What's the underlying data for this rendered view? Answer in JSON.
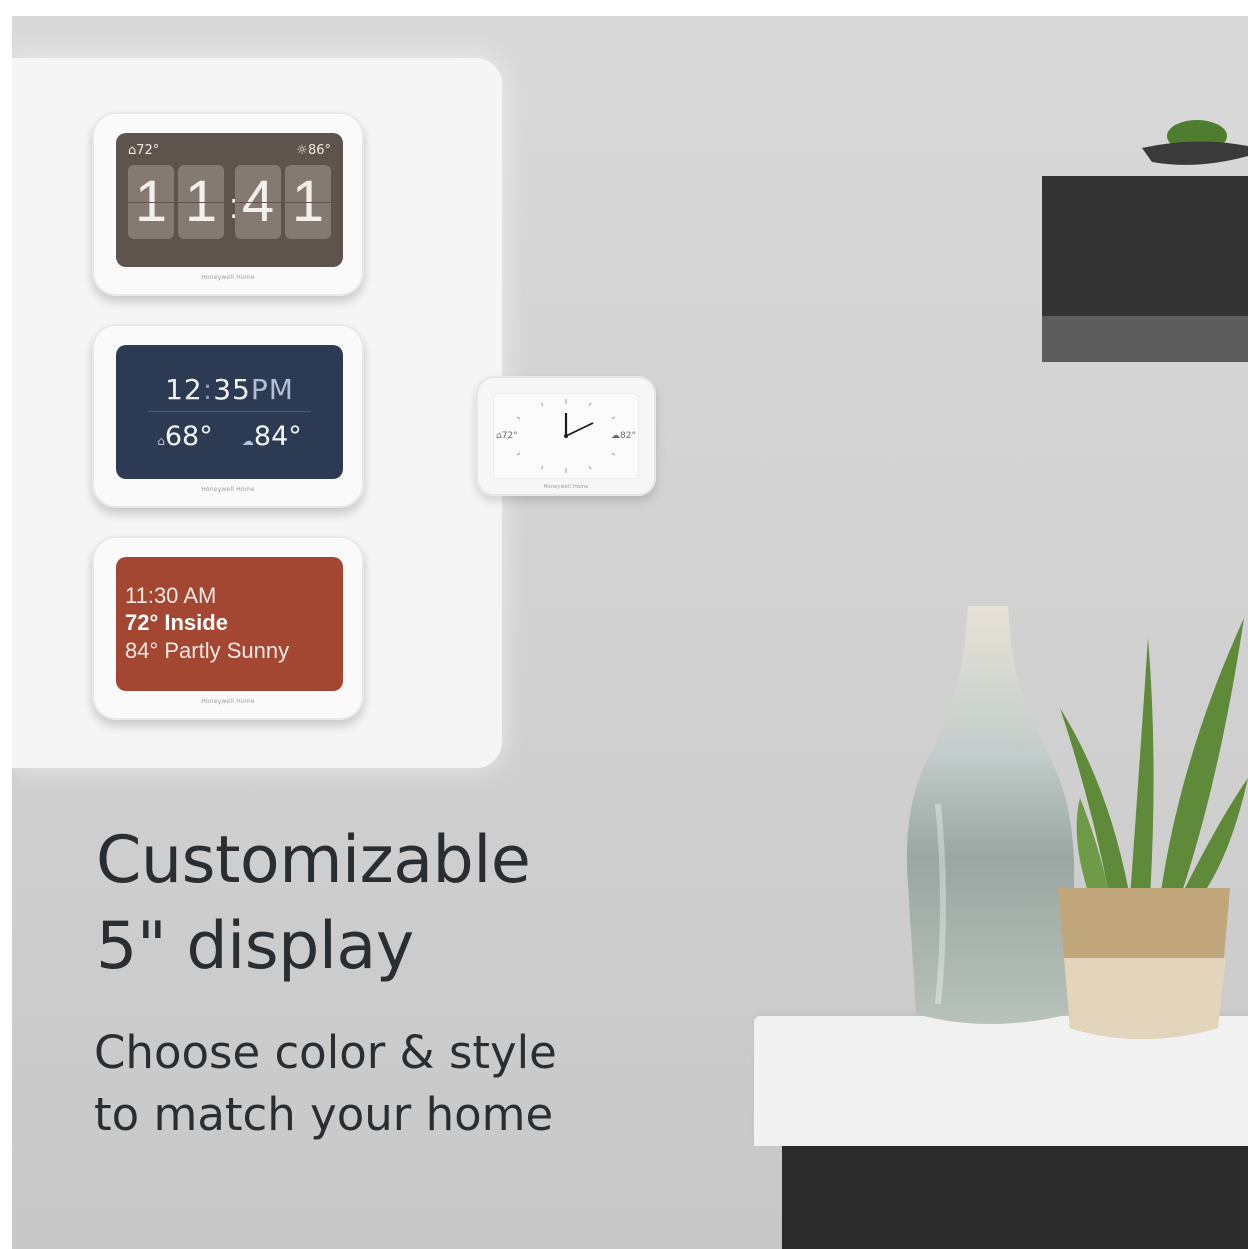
{
  "headline": {
    "line1": "Customizable",
    "line2": "5\" display"
  },
  "subline": {
    "line1": "Choose color & style",
    "line2": "to match your home"
  },
  "brand": "Honeywell Home",
  "flip_display": {
    "indoor": "72°",
    "outdoor": "86°",
    "digits": [
      "1",
      "1",
      "4",
      "1"
    ],
    "colon": ":"
  },
  "navy_display": {
    "time": "12",
    "colon": ":",
    "minutes": "35",
    "ampm": "PM",
    "indoor": "68°",
    "outdoor": "84°"
  },
  "rust_display": {
    "time": "11:30 AM",
    "indoor": "72° Inside",
    "outdoor": "84° Partly Sunny"
  },
  "analog_display": {
    "indoor": "72°",
    "outdoor": "82°"
  },
  "colors": {
    "flip": "#5e544d",
    "navy": "#2d3a54",
    "rust": "#a34733",
    "text": "#2b2e31"
  }
}
